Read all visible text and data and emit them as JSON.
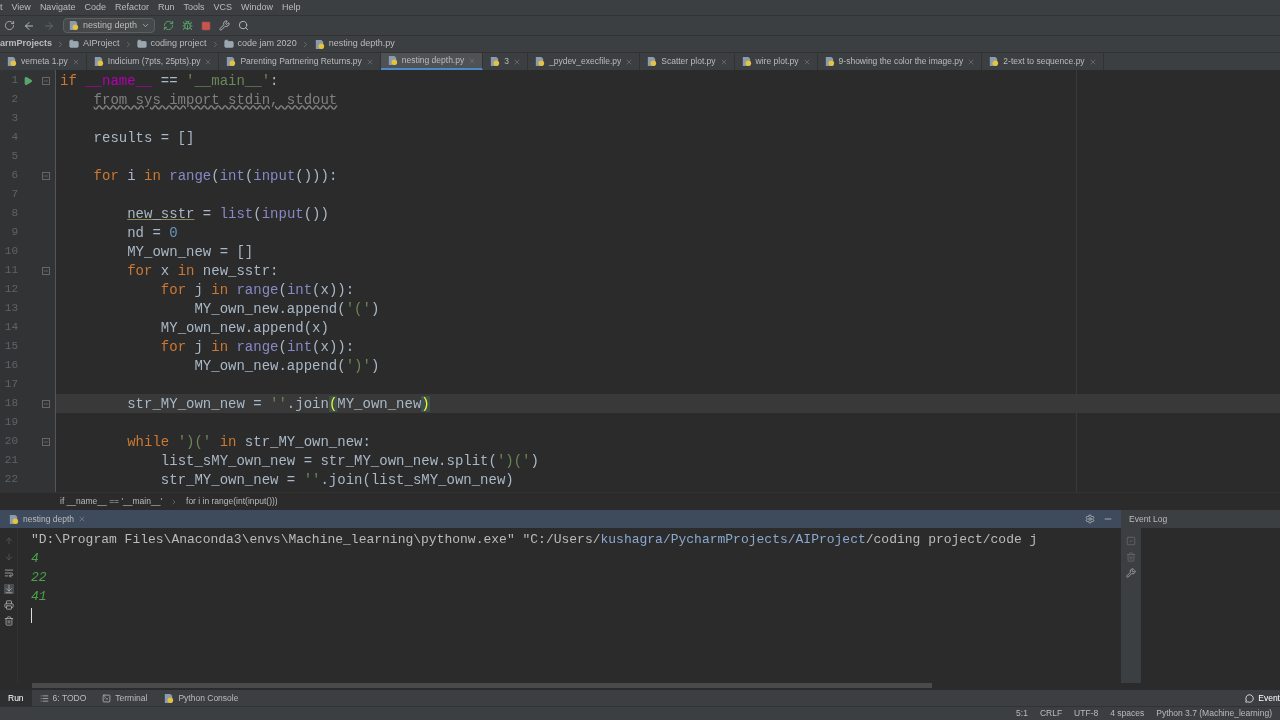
{
  "menu": [
    "t",
    "View",
    "Navigate",
    "Code",
    "Refactor",
    "Run",
    "Tools",
    "VCS",
    "Window",
    "Help"
  ],
  "toolbar": {
    "run_config": "nesting depth"
  },
  "breadcrumb": [
    "armProjects",
    "AIProject",
    "coding project",
    "code jam 2020",
    "nesting depth.py"
  ],
  "tabs": [
    {
      "label": "verneta 1.py",
      "selected": false
    },
    {
      "label": "Indicium (7pts, 25pts).py",
      "selected": false
    },
    {
      "label": "Parenting Partnering Returns.py",
      "selected": false
    },
    {
      "label": "nesting depth.py",
      "selected": true
    },
    {
      "label": "3",
      "selected": false
    },
    {
      "label": "_pydev_execfile.py",
      "selected": false
    },
    {
      "label": "Scatter plot.py",
      "selected": false
    },
    {
      "label": "wire plot.py",
      "selected": false
    },
    {
      "label": "9-showing the color the image.py",
      "selected": false
    },
    {
      "label": "2-text to sequence.py",
      "selected": false
    }
  ],
  "code_lines": [
    {
      "number": "1",
      "run": true,
      "fold": true,
      "current": false,
      "tokens": [
        {
          "kind": "kw",
          "text": "if "
        },
        {
          "kind": "magic",
          "text": "__name__"
        },
        {
          "kind": "plain",
          "text": " == "
        },
        {
          "kind": "str",
          "text": "'__main__'"
        },
        {
          "kind": "plain",
          "text": ":"
        }
      ]
    },
    {
      "number": "2",
      "run": false,
      "fold": false,
      "current": false,
      "tokens": [
        {
          "kind": "unused",
          "text": "    from sys import stdin, stdout"
        }
      ]
    },
    {
      "number": "3",
      "run": false,
      "fold": false,
      "current": false
    },
    {
      "number": "4",
      "run": false,
      "fold": false,
      "current": false,
      "tokens": [
        {
          "kind": "plain",
          "text": "    results = []"
        }
      ]
    },
    {
      "number": "5",
      "run": false,
      "fold": false,
      "current": false
    },
    {
      "number": "6",
      "run": false,
      "fold": true,
      "current": false,
      "tokens": [
        {
          "kind": "kw",
          "text": "    for "
        },
        {
          "kind": "plain",
          "text": "i "
        },
        {
          "kind": "kw",
          "text": "in "
        },
        {
          "kind": "builtin",
          "text": "range"
        },
        {
          "kind": "plain",
          "text": "("
        },
        {
          "kind": "builtin",
          "text": "int"
        },
        {
          "kind": "plain",
          "text": "("
        },
        {
          "kind": "builtin",
          "text": "input"
        },
        {
          "kind": "plain",
          "text": "())):"
        }
      ]
    },
    {
      "number": "7",
      "run": false,
      "fold": false,
      "current": false
    },
    {
      "number": "8",
      "run": false,
      "fold": false,
      "current": false,
      "tokens": [
        {
          "kind": "warn",
          "text": "        new_sstr"
        },
        {
          "kind": "plain",
          "text": " = "
        },
        {
          "kind": "builtin",
          "text": "list"
        },
        {
          "kind": "plain",
          "text": "("
        },
        {
          "kind": "builtin",
          "text": "input"
        },
        {
          "kind": "plain",
          "text": "())"
        }
      ]
    },
    {
      "number": "9",
      "run": false,
      "fold": false,
      "current": false,
      "tokens": [
        {
          "kind": "plain",
          "text": "        nd = "
        },
        {
          "kind": "num",
          "text": "0"
        }
      ]
    },
    {
      "number": "10",
      "run": false,
      "fold": false,
      "current": false,
      "tokens": [
        {
          "kind": "plain",
          "text": "        MY_own_new = []"
        }
      ]
    },
    {
      "number": "11",
      "run": false,
      "fold": true,
      "current": false,
      "tokens": [
        {
          "kind": "kw",
          "text": "        for "
        },
        {
          "kind": "plain",
          "text": "x "
        },
        {
          "kind": "kw",
          "text": "in "
        },
        {
          "kind": "plain",
          "text": "new_sstr:"
        }
      ]
    },
    {
      "number": "12",
      "run": false,
      "fold": false,
      "current": false,
      "tokens": [
        {
          "kind": "kw",
          "text": "            for "
        },
        {
          "kind": "plain",
          "text": "j "
        },
        {
          "kind": "kw",
          "text": "in "
        },
        {
          "kind": "builtin",
          "text": "range"
        },
        {
          "kind": "plain",
          "text": "("
        },
        {
          "kind": "builtin",
          "text": "int"
        },
        {
          "kind": "plain",
          "text": "(x)):"
        }
      ]
    },
    {
      "number": "13",
      "run": false,
      "fold": false,
      "current": false,
      "tokens": [
        {
          "kind": "plain",
          "text": "                MY_own_new.append("
        },
        {
          "kind": "str",
          "text": "'('"
        },
        {
          "kind": "plain",
          "text": ")"
        }
      ]
    },
    {
      "number": "14",
      "run": false,
      "fold": false,
      "current": false,
      "tokens": [
        {
          "kind": "plain",
          "text": "            MY_own_new.append(x)"
        }
      ]
    },
    {
      "number": "15",
      "run": false,
      "fold": false,
      "current": false,
      "tokens": [
        {
          "kind": "kw",
          "text": "            for "
        },
        {
          "kind": "plain",
          "text": "j "
        },
        {
          "kind": "kw",
          "text": "in "
        },
        {
          "kind": "builtin",
          "text": "range"
        },
        {
          "kind": "plain",
          "text": "("
        },
        {
          "kind": "builtin",
          "text": "int"
        },
        {
          "kind": "plain",
          "text": "(x)):"
        }
      ]
    },
    {
      "number": "16",
      "run": false,
      "fold": false,
      "current": false,
      "tokens": [
        {
          "kind": "plain",
          "text": "                MY_own_new.append("
        },
        {
          "kind": "str",
          "text": "')'"
        },
        {
          "kind": "plain",
          "text": ")"
        }
      ]
    },
    {
      "number": "17",
      "run": false,
      "fold": false,
      "current": false
    },
    {
      "number": "18",
      "run": false,
      "fold": true,
      "current": true,
      "tokens": [
        {
          "kind": "plain",
          "text": "        str_MY_own_new = "
        },
        {
          "kind": "str",
          "text": "''"
        },
        {
          "kind": "plain",
          "text": ".join"
        },
        {
          "kind": "brace",
          "text": "("
        },
        {
          "kind": "plain",
          "text": "MY_own_new"
        },
        {
          "kind": "brace",
          "text": ")"
        }
      ]
    },
    {
      "number": "19",
      "run": false,
      "fold": false,
      "current": false
    },
    {
      "number": "20",
      "run": false,
      "fold": true,
      "current": false,
      "tokens": [
        {
          "kind": "kw",
          "text": "        while "
        },
        {
          "kind": "str",
          "text": "')('"
        },
        {
          "kind": "kw",
          "text": " in "
        },
        {
          "kind": "plain",
          "text": "str_MY_own_new:"
        }
      ]
    },
    {
      "number": "21",
      "run": false,
      "fold": false,
      "current": false,
      "tokens": [
        {
          "kind": "plain",
          "text": "            list_sMY_own_new = str_MY_own_new.split("
        },
        {
          "kind": "str",
          "text": "')('"
        },
        {
          "kind": "plain",
          "text": ")"
        }
      ]
    },
    {
      "number": "22",
      "run": false,
      "fold": false,
      "current": false,
      "tokens": [
        {
          "kind": "plain",
          "text": "            str_MY_own_new = "
        },
        {
          "kind": "str",
          "text": "''"
        },
        {
          "kind": "plain",
          "text": ".join(list_sMY_own_new)"
        }
      ]
    }
  ],
  "editor_breadcrumb": [
    "if __name__ == '__main__'",
    "for i in range(int(input()))"
  ],
  "run_panel": {
    "tab": "nesting depth",
    "side_title": "Event Log",
    "console_lines": [
      {
        "kind": "command",
        "segments": [
          {
            "kind": "text",
            "text": "\"D:\\Program Files\\Anaconda3\\envs\\Machine_learning\\pythonw.exe\" \"C:/Users/"
          },
          {
            "kind": "link",
            "text": "kushagra/PycharmProjects/AIProject"
          },
          {
            "kind": "text",
            "text": "/coding project/code j"
          }
        ]
      },
      {
        "kind": "input",
        "segments": [
          {
            "kind": "text",
            "text": "4"
          }
        ]
      },
      {
        "kind": "input",
        "segments": [
          {
            "kind": "text",
            "text": "22"
          }
        ]
      },
      {
        "kind": "input",
        "segments": [
          {
            "kind": "text",
            "text": "41"
          }
        ]
      }
    ]
  },
  "tool_tabs": [
    {
      "label": "Run",
      "selected": true
    },
    {
      "label": "6: TODO",
      "selected": false
    },
    {
      "label": "Terminal",
      "selected": false
    },
    {
      "label": "Python Console",
      "selected": false
    }
  ],
  "event_button": "Event",
  "status_bar": [
    "5:1",
    "CRLF",
    "UTF-8",
    "4 spaces",
    "Python 3.7 (Machine_learning)"
  ]
}
